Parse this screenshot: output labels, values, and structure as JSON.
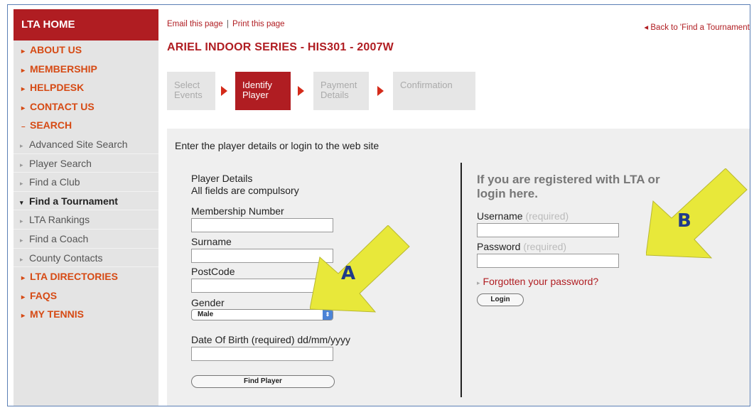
{
  "sidebar": {
    "home": "LTA HOME",
    "items": [
      {
        "label": "ABOUT US",
        "marker": "▸",
        "type": "top"
      },
      {
        "label": "MEMBERSHIP",
        "marker": "▸",
        "type": "top"
      },
      {
        "label": "HELPDESK",
        "marker": "▸",
        "type": "top"
      },
      {
        "label": "CONTACT US",
        "marker": "▸",
        "type": "top"
      },
      {
        "label": "SEARCH",
        "marker": "–",
        "type": "top"
      },
      {
        "label": "Advanced Site Search",
        "marker": "▸",
        "type": "sub"
      },
      {
        "label": "Player Search",
        "marker": "▸",
        "type": "sub"
      },
      {
        "label": "Find a Club",
        "marker": "▸",
        "type": "sub"
      },
      {
        "label": "Find a Tournament",
        "marker": "▾",
        "type": "sub-active"
      },
      {
        "label": "LTA Rankings",
        "marker": "▸",
        "type": "sub"
      },
      {
        "label": "Find a Coach",
        "marker": "▸",
        "type": "sub"
      },
      {
        "label": "County Contacts",
        "marker": "▸",
        "type": "sub"
      },
      {
        "label": "LTA DIRECTORIES",
        "marker": "▸",
        "type": "top"
      },
      {
        "label": "FAQS",
        "marker": "▸",
        "type": "top"
      },
      {
        "label": "MY TENNIS",
        "marker": "▸",
        "type": "top"
      }
    ]
  },
  "header": {
    "email_link": "Email this page",
    "separator": "|",
    "print_link": "Print this page",
    "back_link": "◂ Back to 'Find a Tournament'",
    "title": "ARIEL INDOOR SERIES - HIS301 - 2007W"
  },
  "steps": {
    "step1": {
      "line1": "Select",
      "line2": "Events"
    },
    "step2": {
      "line1": "Identify",
      "line2": "Player"
    },
    "step3": {
      "line1": "Payment",
      "line2": "Details"
    },
    "step4": {
      "line1": "Confirmation",
      "line2": ""
    }
  },
  "form": {
    "intro": "Enter the player details or login to the web site",
    "player_details": "Player Details",
    "compulsory": "All fields are compulsory",
    "membership_label": "Membership Number",
    "membership_value": "",
    "surname_label": "Surname",
    "surname_value": "",
    "postcode_label": "PostCode",
    "postcode_value": "",
    "gender_label": "Gender",
    "gender_selected": "Male",
    "dob_label": "Date Of Birth (required) dd/mm/yyyy",
    "dob_value": "",
    "find_button": "Find Player"
  },
  "login": {
    "heading_line1": "If you are registered with LTA or",
    "heading_line2": "login here.",
    "username_label": "Username",
    "username_required": "(required)",
    "username_value": "",
    "password_label": "Password",
    "password_required": "(required)",
    "password_value": "",
    "forgot_marker": "▸",
    "forgot_link": "Forgotten your password?",
    "login_button": "Login"
  },
  "annotations": {
    "a_letter": "A",
    "b_letter": "B",
    "arrow_color": "#e8e83a",
    "letter_color": "#1f3a8a"
  },
  "colors": {
    "brand_red": "#b01d22",
    "nav_orange": "#d64a14",
    "sidebar_bg": "#e4e4e4",
    "panel_bg": "#efefef"
  }
}
